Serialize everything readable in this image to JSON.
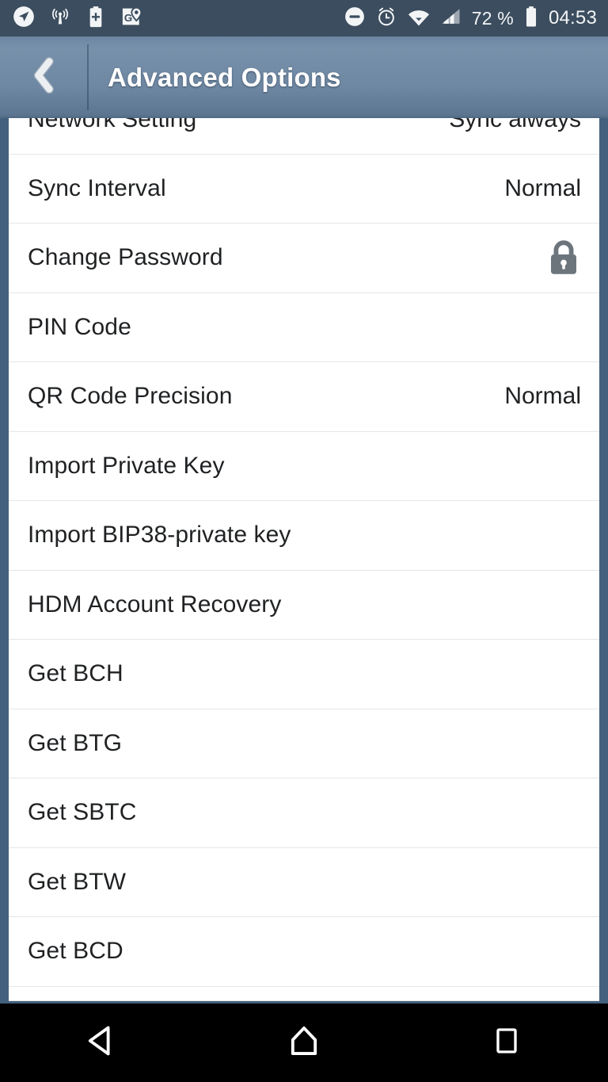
{
  "status_bar": {
    "background": "#3b4d5e",
    "left_icons": [
      {
        "name": "location-arrow-icon",
        "label": "location"
      },
      {
        "name": "broadcast-signal-icon",
        "label": "broadcast"
      },
      {
        "name": "battery-plus-icon",
        "label": "battery saver"
      },
      {
        "name": "google-maps-icon",
        "label": "maps"
      }
    ],
    "right_icons": [
      {
        "name": "do-not-disturb-icon",
        "label": "do not disturb"
      },
      {
        "name": "alarm-clock-icon",
        "label": "alarm"
      },
      {
        "name": "wifi-icon",
        "label": "wifi"
      },
      {
        "name": "cellular-signal-icon",
        "label": "signal"
      }
    ],
    "battery_percent": "72 %",
    "clock": "04:53"
  },
  "action_bar": {
    "title": "Advanced Options",
    "back_icon": "chevron-left-icon",
    "background_top": "#7891ab",
    "background_bottom": "#4e6880",
    "title_color": "#ffffff"
  },
  "settings_list": {
    "background": "#43607e",
    "row_background": "#ffffff",
    "divider_color": "#e6e6e6",
    "label_color": "#1f2123",
    "rows": [
      {
        "label": "Network Setting",
        "value": "Sync always",
        "icon": "",
        "clipped": true
      },
      {
        "label": "Sync Interval",
        "value": "Normal",
        "icon": ""
      },
      {
        "label": "Change Password",
        "value": "",
        "icon": "lock-icon"
      },
      {
        "label": "PIN Code",
        "value": "",
        "icon": ""
      },
      {
        "label": "QR Code Precision",
        "value": "Normal",
        "icon": ""
      },
      {
        "label": "Import Private Key",
        "value": "",
        "icon": ""
      },
      {
        "label": "Import BIP38-private key",
        "value": "",
        "icon": ""
      },
      {
        "label": "HDM Account Recovery",
        "value": "",
        "icon": ""
      },
      {
        "label": "Get BCH",
        "value": "",
        "icon": ""
      },
      {
        "label": "Get BTG",
        "value": "",
        "icon": ""
      },
      {
        "label": "Get SBTC",
        "value": "",
        "icon": ""
      },
      {
        "label": "Get BTW",
        "value": "",
        "icon": ""
      },
      {
        "label": "Get BCD",
        "value": "",
        "icon": ""
      }
    ]
  },
  "nav_bar": {
    "background": "#000000",
    "buttons": [
      {
        "name": "nav-back-button",
        "icon": "back-triangle-icon"
      },
      {
        "name": "nav-home-button",
        "icon": "home-icon"
      },
      {
        "name": "nav-recents-button",
        "icon": "recents-square-icon"
      }
    ]
  }
}
